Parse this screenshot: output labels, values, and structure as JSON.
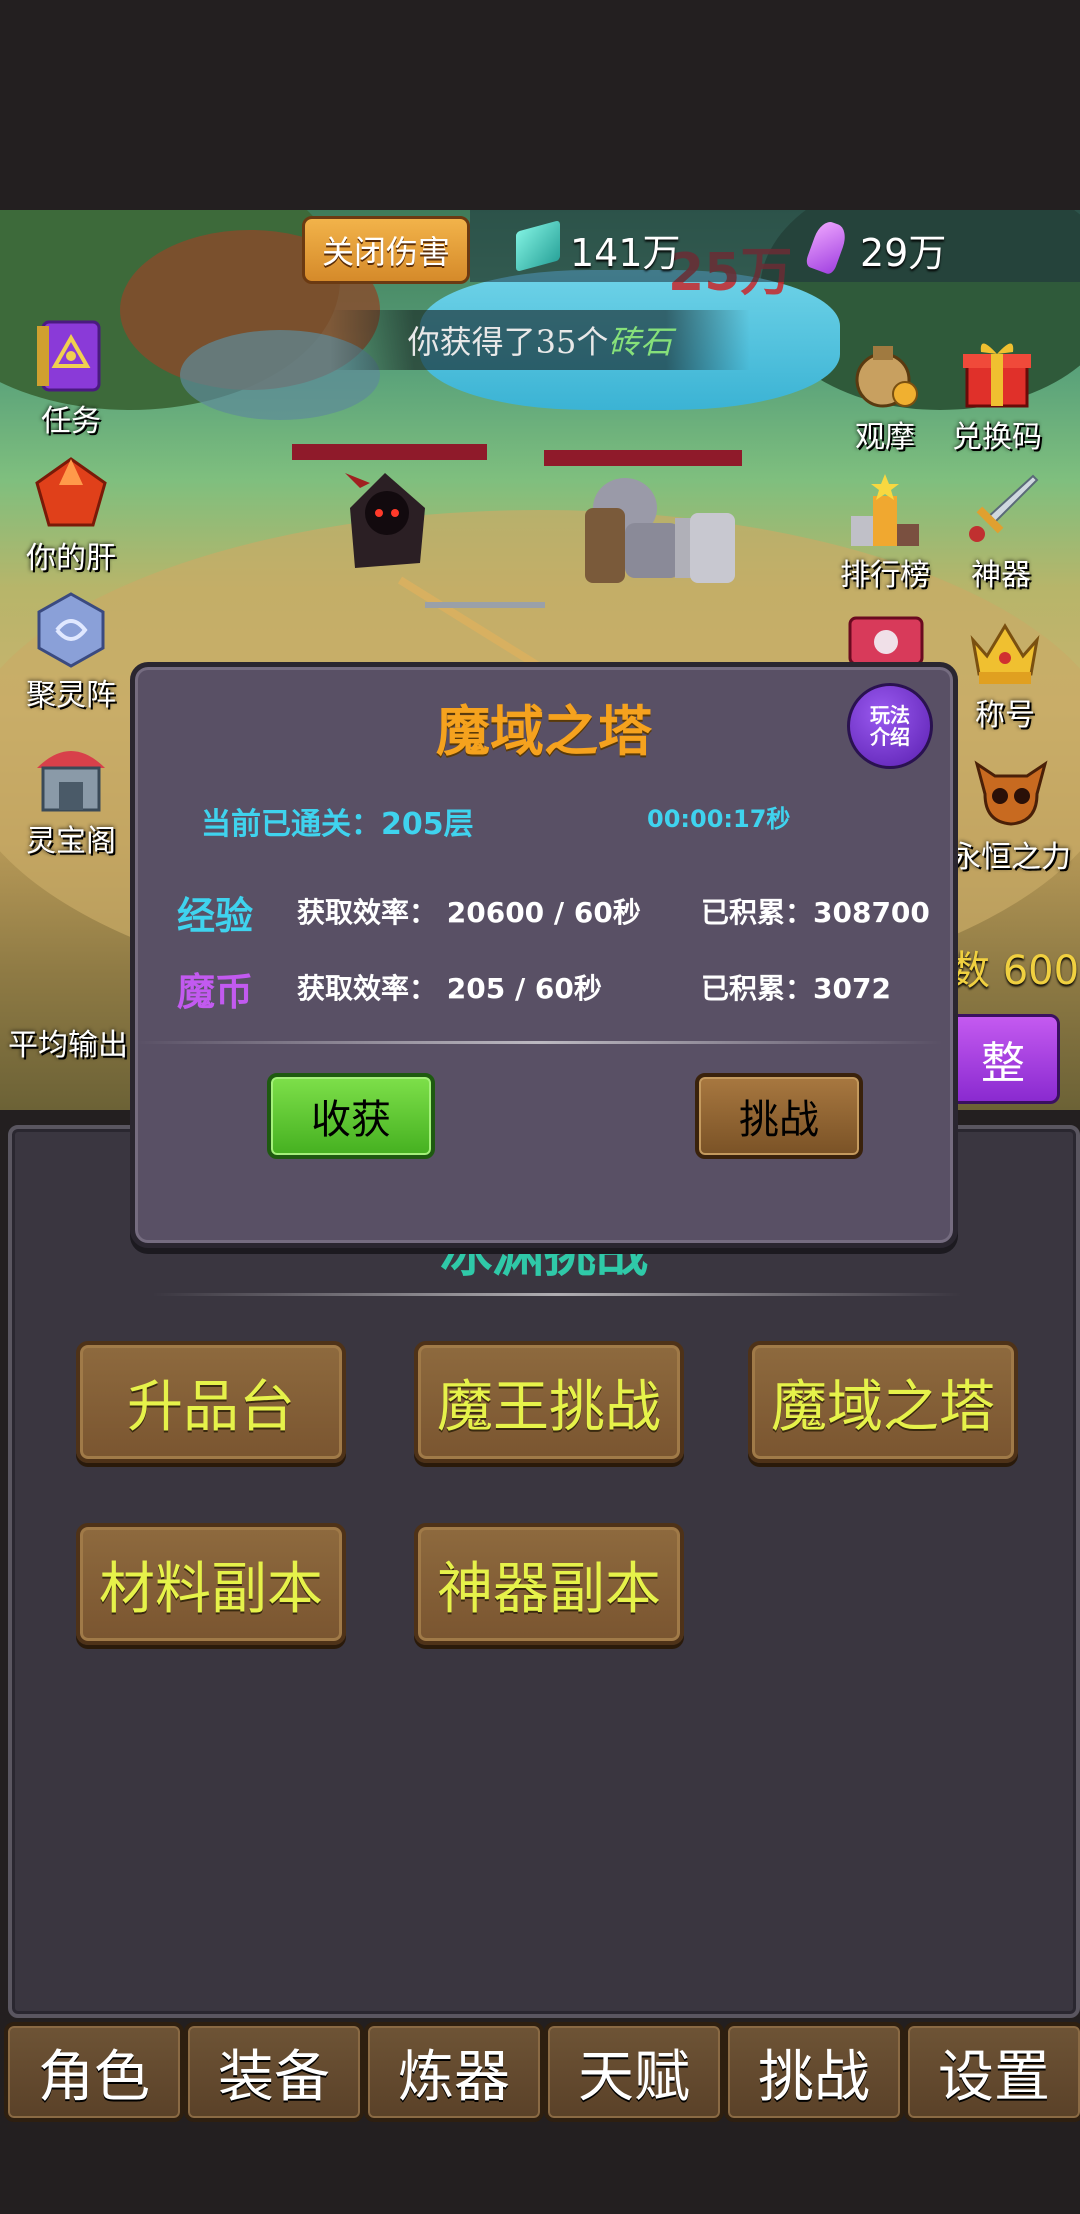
{
  "top_bar": {
    "close_damage_label": "关闭伤害",
    "diamond_amount": "141万",
    "crystal_amount": "29万",
    "damage_popup": "25万"
  },
  "notice": {
    "prefix": "你获得了35个",
    "item": "砖石"
  },
  "left_menu": [
    {
      "label": "任务",
      "icon": "quest-book-icon"
    },
    {
      "label": "你的肝",
      "icon": "red-gem-icon"
    },
    {
      "label": "聚灵阵",
      "icon": "spirit-stone-icon"
    },
    {
      "label": "灵宝阁",
      "icon": "shop-icon"
    }
  ],
  "left_stat_label": "平均输出",
  "right_menu": [
    {
      "label": "观摩",
      "icon": "money-bag-icon"
    },
    {
      "label": "兑换码",
      "icon": "gift-box-icon"
    },
    {
      "label": "排行榜",
      "icon": "podium-icon"
    },
    {
      "label": "神器",
      "icon": "sword-icon"
    },
    {
      "label": "称号",
      "icon": "crown-icon"
    },
    {
      "label": "永恒之力",
      "icon": "skull-icon"
    }
  ],
  "right_stat_text": "数 600",
  "right_button_label": "整",
  "dialog": {
    "title": "魔域之塔",
    "intro_line1": "玩法",
    "intro_line2": "介绍",
    "cleared_label": "当前已通关：205层",
    "timer": "00:00:17秒",
    "rows": [
      {
        "name": "经验",
        "rate": "获取效率： 20600 /  60秒",
        "total": "已积累：308700",
        "color": "#3fd3ee"
      },
      {
        "name": "魔币",
        "rate": "获取效率： 205 /  60秒",
        "total": "已积累：3072",
        "color": "#c25af0"
      }
    ],
    "harvest_label": "收获",
    "challenge_label": "挑战"
  },
  "panel": {
    "title": "冰渊挑战",
    "buttons": [
      "升品台",
      "魔王挑战",
      "魔域之塔",
      "材料副本",
      "神器副本"
    ]
  },
  "tabs": [
    "角色",
    "装备",
    "炼器",
    "天赋",
    "挑战",
    "设置"
  ],
  "colors": {
    "accent_orange": "#f5a21e",
    "accent_cyan": "#3fd3ee",
    "menu_text_yellow": "#e6f24a",
    "dialog_bg": "#595065"
  }
}
